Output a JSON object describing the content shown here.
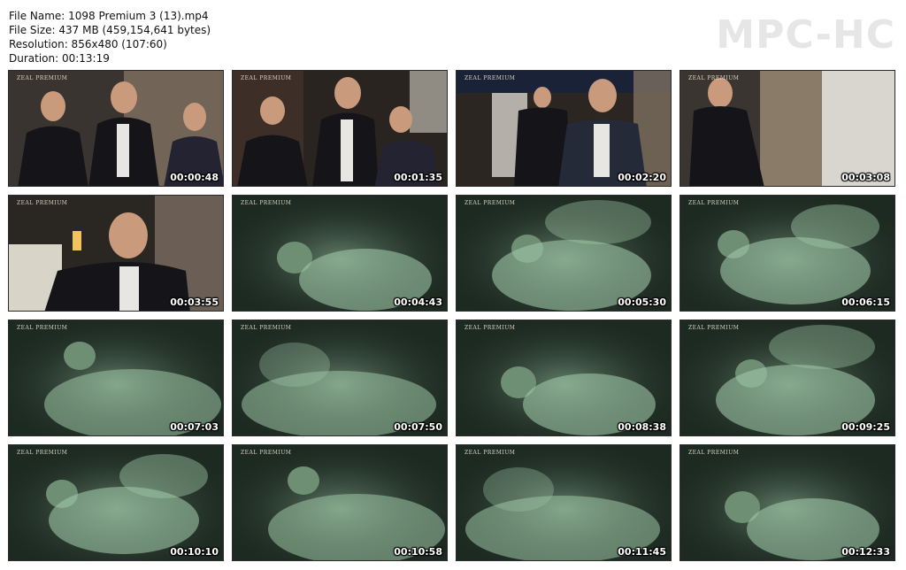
{
  "info": {
    "file_name": "File Name: 1098 Premium 3 (13).mp4",
    "file_size": "File Size: 437 MB (459,154,641 bytes)",
    "resolution": "Resolution: 856x480 (107:60)",
    "duration": "Duration: 00:13:19"
  },
  "brand": "MPC-HC",
  "watermark": "ZEAL PREMIUM",
  "thumbnails": [
    {
      "time": "00:00:48",
      "scene": "lit"
    },
    {
      "time": "00:01:35",
      "scene": "lit"
    },
    {
      "time": "00:02:20",
      "scene": "lit"
    },
    {
      "time": "00:03:08",
      "scene": "lit"
    },
    {
      "time": "00:03:55",
      "scene": "lit"
    },
    {
      "time": "00:04:43",
      "scene": "night"
    },
    {
      "time": "00:05:30",
      "scene": "night"
    },
    {
      "time": "00:06:15",
      "scene": "night"
    },
    {
      "time": "00:07:03",
      "scene": "night"
    },
    {
      "time": "00:07:50",
      "scene": "night"
    },
    {
      "time": "00:08:38",
      "scene": "night"
    },
    {
      "time": "00:09:25",
      "scene": "night"
    },
    {
      "time": "00:10:10",
      "scene": "night"
    },
    {
      "time": "00:10:58",
      "scene": "night"
    },
    {
      "time": "00:11:45",
      "scene": "night"
    },
    {
      "time": "00:12:33",
      "scene": "night"
    }
  ],
  "colors": {
    "lit_bg": "#3a3430",
    "lit_wall": "#8a7a68",
    "suit": "#141419",
    "shirt": "#e8e6e2",
    "skin": "#c99a7c",
    "night_bg": "#1d2a22",
    "night_glow": "#9fc7a6"
  }
}
